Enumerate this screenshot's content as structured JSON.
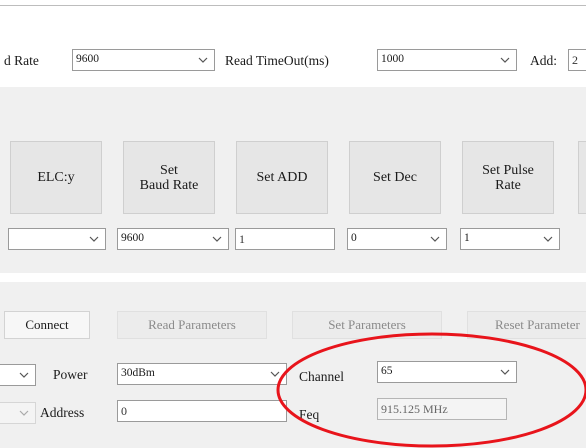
{
  "top_row": {
    "baud_label": "d Rate",
    "baud_value": "9600",
    "timeout_label": "Read TimeOut(ms)",
    "timeout_value": "1000",
    "add_label": "Add:",
    "add_value": "2"
  },
  "set_buttons": [
    {
      "label": "ELC:y"
    },
    {
      "label": "Set\nBaud Rate"
    },
    {
      "label": "Set ADD"
    },
    {
      "label": "Set Dec"
    },
    {
      "label": "Set Pulse\nRate"
    }
  ],
  "set_values": {
    "elc": "",
    "baud": "9600",
    "add": "1",
    "dec": "0",
    "pulse": "1"
  },
  "actions": {
    "connect": "Connect",
    "read": "Read Parameters",
    "set": "Set Parameters",
    "reset": "Reset Parameter"
  },
  "params": {
    "power_label": "Power",
    "power_value": "30dBm",
    "channel_label": "Channel",
    "channel_value": "65",
    "address_label": "Address",
    "address_value": "0",
    "freq_label": "Feq",
    "freq_value": "915.125 MHz"
  },
  "annotation": {
    "color": "#e8141b"
  }
}
